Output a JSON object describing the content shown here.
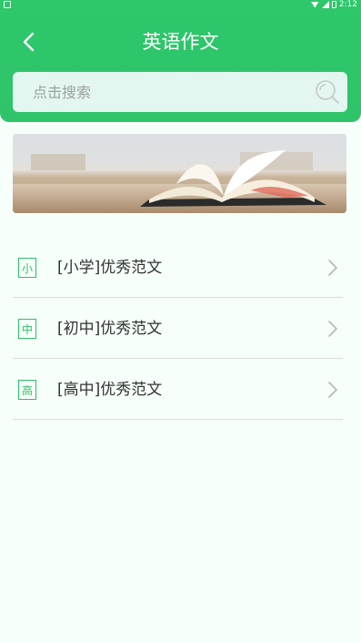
{
  "status_bar": {
    "time": "2:12"
  },
  "header": {
    "title": "英语作文"
  },
  "search": {
    "placeholder": "点击搜索"
  },
  "categories": [
    {
      "badge": "小",
      "label": "[小学]优秀范文"
    },
    {
      "badge": "中",
      "label": "[初中]优秀范文"
    },
    {
      "badge": "高",
      "label": "[高中]优秀范文"
    }
  ],
  "colors": {
    "accent": "#2ec76a",
    "search_bg": "#e3f7f0",
    "page_bg": "#f6fff9"
  }
}
